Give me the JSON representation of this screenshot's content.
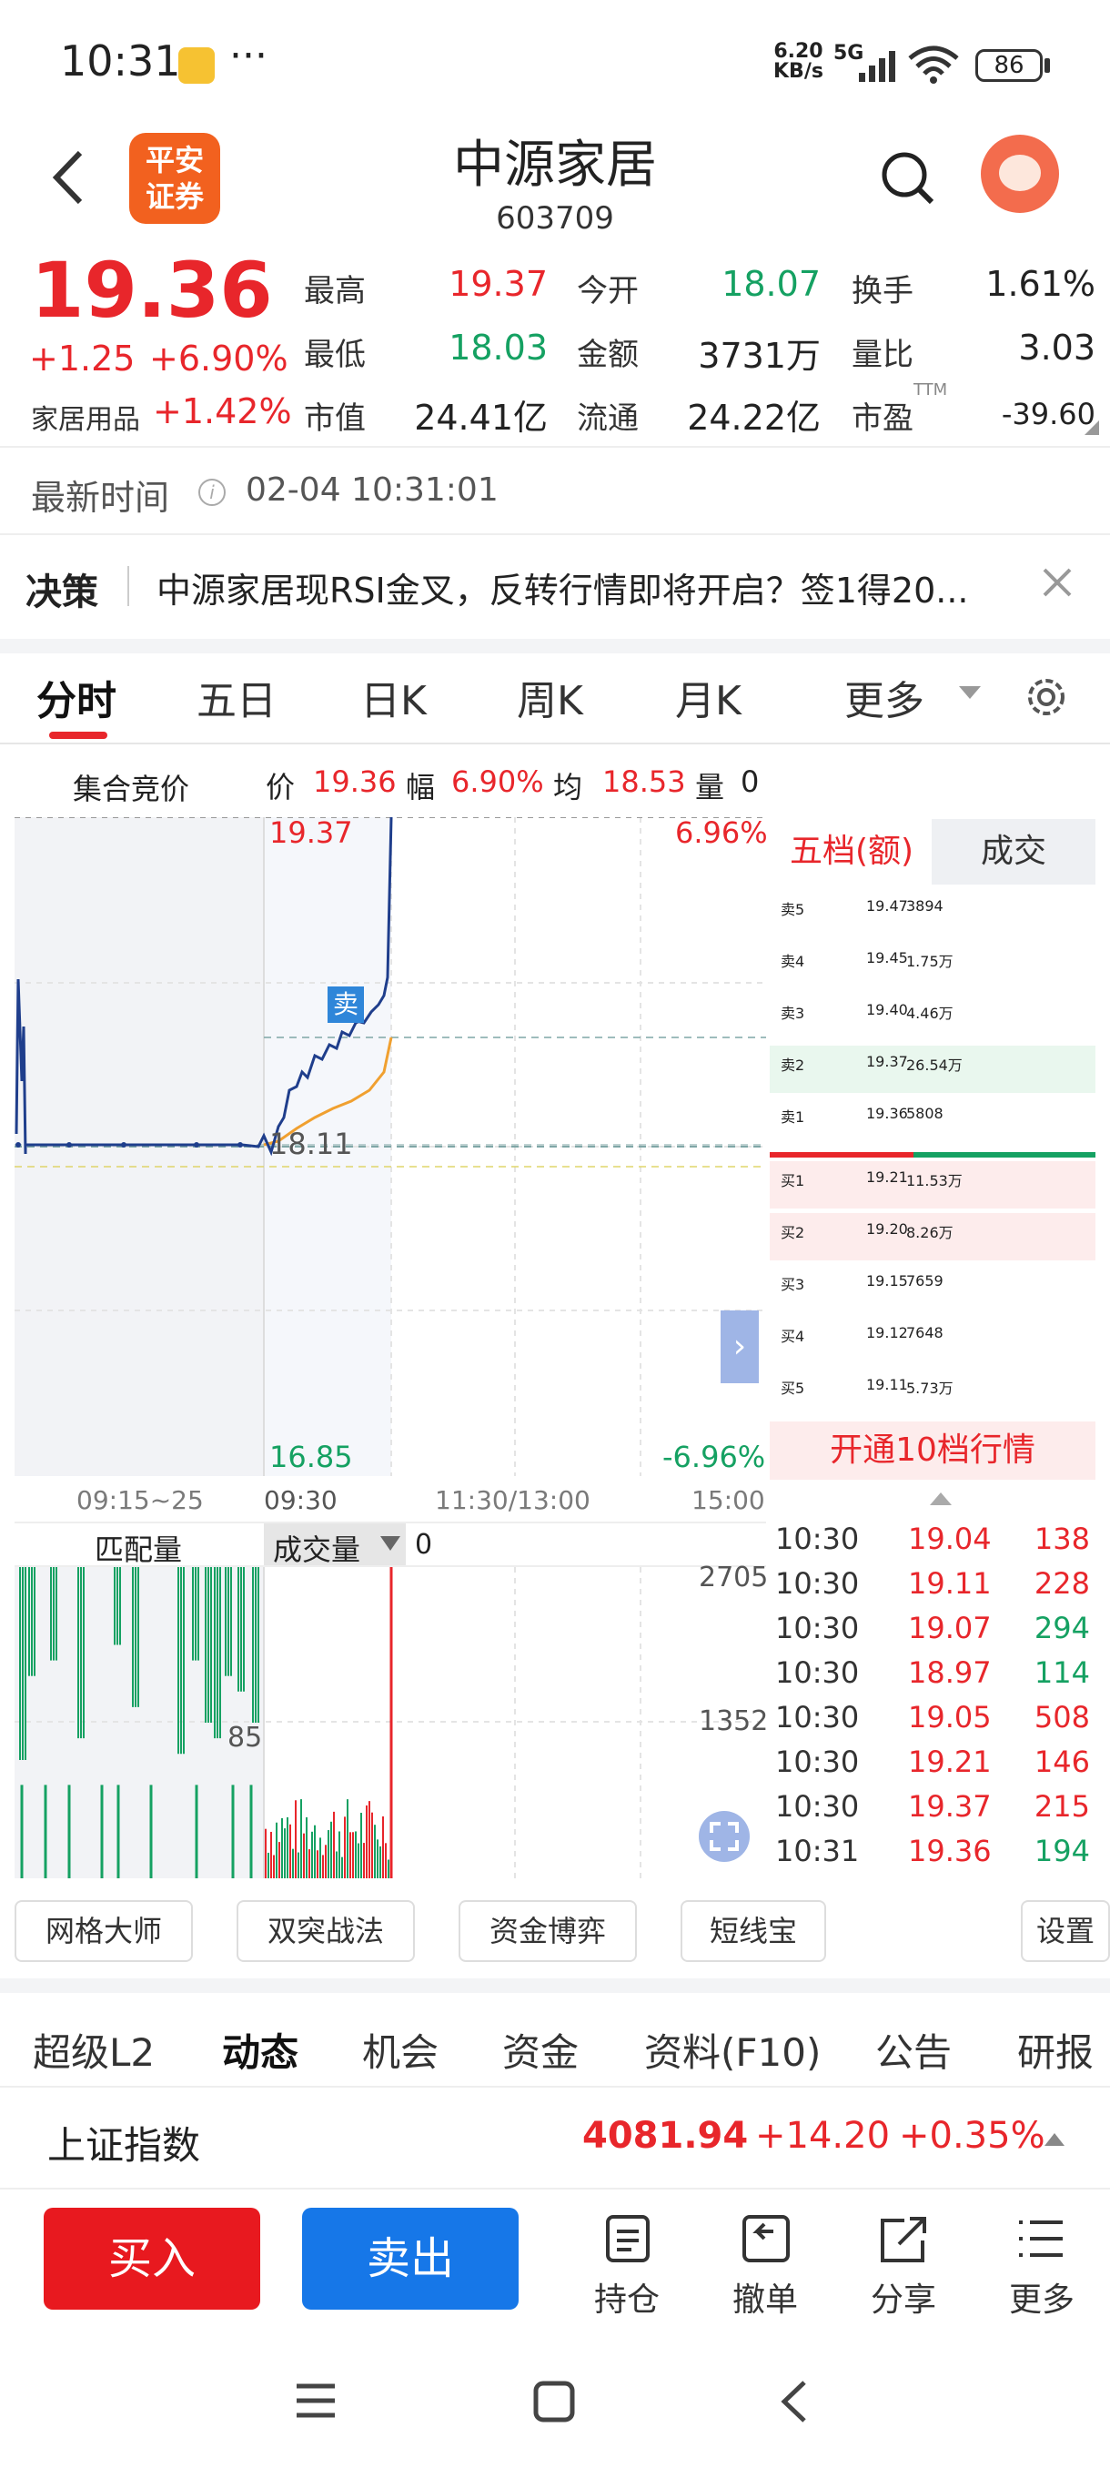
{
  "status_bar": {
    "time": "10:31",
    "dots": "···",
    "net_speed_top": "6.20",
    "net_speed_bottom": "KB/s",
    "signal": "5G",
    "battery": "86"
  },
  "header": {
    "broker_logo": "平安证券",
    "stock_name": "中源家居",
    "stock_code": "603709"
  },
  "quote": {
    "price": "19.36",
    "change": "+1.25",
    "change_pct": "+6.90%",
    "sector": "家居用品",
    "sector_pct": "+1.42%",
    "high_label": "最高",
    "high": "19.37",
    "open_label": "今开",
    "open": "18.07",
    "turnover_label": "换手",
    "turnover": "1.61%",
    "low_label": "最低",
    "low": "18.03",
    "amount_label": "金额",
    "amount": "3731万",
    "vol_ratio_label": "量比",
    "vol_ratio": "3.03",
    "mcap_label": "市值",
    "mcap": "24.41亿",
    "float_label": "流通",
    "float": "24.22亿",
    "pe_label": "市盈",
    "pe_sup": "TTM",
    "pe": "-39.60"
  },
  "update": {
    "label": "最新时间",
    "time": "02-04 10:31:01"
  },
  "decision": {
    "label": "决策",
    "text": "中源家居现RSI金叉，反转行情即将开启？签1得20..."
  },
  "chart_tabs": [
    "分时",
    "五日",
    "日K",
    "周K",
    "月K",
    "更多"
  ],
  "info_bar": {
    "auction": "集合竞价",
    "price_l": "价",
    "price": "19.36",
    "amp_l": "幅",
    "amp": "6.90%",
    "avg_l": "均",
    "avg": "18.53",
    "vol_l": "量",
    "vol": "0"
  },
  "chart": {
    "top_price": "19.37",
    "top_pct": "6.96%",
    "mid_price": "18.11",
    "bottom_price": "16.85",
    "bottom_pct": "-6.96%",
    "sell_marker": "卖",
    "x_labels": [
      "09:15~25",
      "09:30",
      "11:30/13:00",
      "15:00"
    ]
  },
  "order_book": {
    "tab_active": "五档(额)",
    "tab_other": "成交",
    "asks": [
      {
        "label": "卖5",
        "price": "19.47",
        "vol": "3894"
      },
      {
        "label": "卖4",
        "price": "19.45",
        "vol": "1.75万"
      },
      {
        "label": "卖3",
        "price": "19.40",
        "vol": "4.46万"
      },
      {
        "label": "卖2",
        "price": "19.37",
        "vol": "26.54万"
      },
      {
        "label": "卖1",
        "price": "19.36",
        "vol": "5808"
      }
    ],
    "bids": [
      {
        "label": "买1",
        "price": "19.21",
        "vol": "11.53万"
      },
      {
        "label": "买2",
        "price": "19.20",
        "vol": "8.26万"
      },
      {
        "label": "买3",
        "price": "19.15",
        "vol": "7659"
      },
      {
        "label": "买4",
        "price": "19.12",
        "vol": "7648"
      },
      {
        "label": "买5",
        "price": "19.11",
        "vol": "5.73万"
      }
    ],
    "open_l10": "开通10档行情"
  },
  "volume": {
    "match_label": "匹配量",
    "vol_label": "成交量",
    "vol_value": "0",
    "y_top": "2705",
    "y_mid": "1352",
    "left_mark": "85"
  },
  "ticks": [
    {
      "t": "10:30",
      "p": "19.04",
      "v": "138",
      "pc": "red",
      "vc": "red"
    },
    {
      "t": "10:30",
      "p": "19.11",
      "v": "228",
      "pc": "red",
      "vc": "red"
    },
    {
      "t": "10:30",
      "p": "19.07",
      "v": "294",
      "pc": "red",
      "vc": "green"
    },
    {
      "t": "10:30",
      "p": "18.97",
      "v": "114",
      "pc": "red",
      "vc": "green"
    },
    {
      "t": "10:30",
      "p": "19.05",
      "v": "508",
      "pc": "red",
      "vc": "red"
    },
    {
      "t": "10:30",
      "p": "19.21",
      "v": "146",
      "pc": "red",
      "vc": "red"
    },
    {
      "t": "10:30",
      "p": "19.37",
      "v": "215",
      "pc": "red",
      "vc": "red"
    },
    {
      "t": "10:31",
      "p": "19.36",
      "v": "194",
      "pc": "red",
      "vc": "green"
    }
  ],
  "tools": [
    "网格大师",
    "双突战法",
    "资金博弈",
    "短线宝"
  ],
  "settings": "设置",
  "categories": [
    "超级L2",
    "动态",
    "机会",
    "资金",
    "资料(F10)",
    "公告",
    "研报"
  ],
  "index": {
    "name": "上证指数",
    "value": "4081.94",
    "change": "+14.20",
    "pct": "+0.35%"
  },
  "bottom": {
    "buy": "买入",
    "sell": "卖出",
    "hold": "持仓",
    "cancel": "撤单",
    "share": "分享",
    "more": "更多"
  },
  "colors": {
    "up": "#e8262b",
    "down": "#15a162",
    "accent_blue": "#1677e8",
    "line": "#1f3e8c",
    "avg_line": "#f0a030"
  }
}
